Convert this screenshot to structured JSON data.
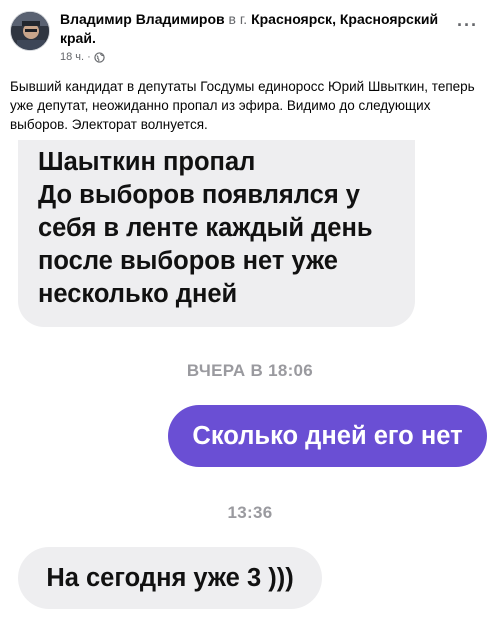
{
  "post": {
    "author": "Владимир Владимиров",
    "location_prefix": " в г. ",
    "location": "Красноярск, Красноярский край.",
    "time": "18 ч.",
    "separator": "·",
    "more_label": "···",
    "text": "Бывший кандидат в депутаты Госдумы единоросс Юрий Швыткин, теперь уже депутат, неожиданно пропал из эфира. Видимо до следующих выборов. Электорат волнуется."
  },
  "chat": {
    "incoming_message_lines": [
      "Шаыткин пропал",
      "До выборов появлялся у",
      "себя в ленте каждый день",
      "после выборов нет уже",
      "несколько дней"
    ],
    "timestamp_1": "ВЧЕРА В 18:06",
    "outgoing_message": "Сколько дней его нет",
    "timestamp_2": "13:36",
    "incoming_message_2": "На сегодня уже 3 )))"
  },
  "colors": {
    "outgoing_bubble": "#6a4fd4",
    "incoming_bubble": "#eeeef0",
    "timestamp_text": "#9a9a9f"
  },
  "icons": {
    "privacy": "globe-icon",
    "menu": "more-options-icon"
  }
}
